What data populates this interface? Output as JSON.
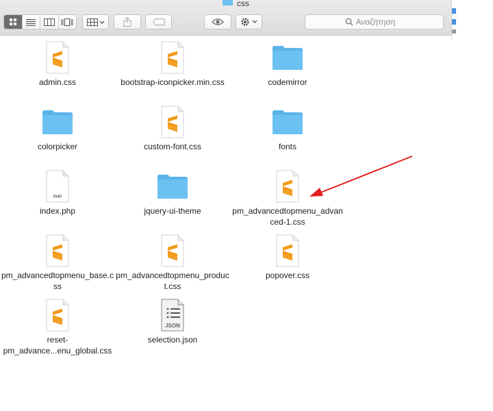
{
  "window": {
    "title": "css"
  },
  "toolbar": {
    "view_buttons": [
      "icon-view",
      "list-view",
      "column-view",
      "cover-flow-view"
    ],
    "search_placeholder": "Αναζήτηση"
  },
  "files": [
    {
      "name": "admin.css",
      "type": "css"
    },
    {
      "name": "bootstrap-iconpicker.min.css",
      "type": "css"
    },
    {
      "name": "codemirror",
      "type": "folder"
    },
    {
      "name": "colorpicker",
      "type": "folder"
    },
    {
      "name": "custom-font.css",
      "type": "css"
    },
    {
      "name": "fonts",
      "type": "folder"
    },
    {
      "name": "index.php",
      "type": "php",
      "badge": "PHP"
    },
    {
      "name": "jquery-ui-theme",
      "type": "folder"
    },
    {
      "name": "pm_advancedtopmenu_advanced-1.css",
      "type": "css"
    },
    {
      "name": "pm_advancedtopmenu_base.css",
      "type": "css"
    },
    {
      "name": "pm_advancedtopmenu_product.css",
      "type": "css"
    },
    {
      "name": "popover.css",
      "type": "css"
    },
    {
      "name": "reset-pm_advance...enu_global.css",
      "type": "css"
    },
    {
      "name": "selection.json",
      "type": "json",
      "badge": "JSON"
    }
  ],
  "colors": {
    "folder": "#6cc1f2",
    "sublime_logo": "#f29a1a",
    "arrow": "#e0201f"
  }
}
